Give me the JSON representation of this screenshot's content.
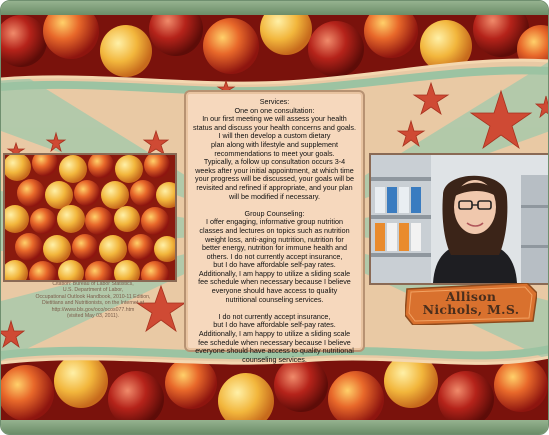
{
  "services": {
    "lines_intro": [
      "Services:",
      "One on one consultation:",
      "In our first meeting we will assess your health",
      "status and discuss your health concerns and goals.",
      "I will then develop a custom dietary",
      "plan along with lifestyle and supplement",
      "recommendations to meet your goals.",
      "Typically, a follow up consultation occurs 3-4",
      "weeks after your initial appointment, at which time",
      "your progress will be discussed, your goals will be",
      "revisited and refined if appropriate, and your plan",
      "will be modified if necessary."
    ],
    "lines_group": [
      "Group Counseling:",
      "I offer engaging, informative group nutrition",
      "classes and lectures on topics such as nutrition",
      "weight loss, anti-aging nutrition, nutrition for",
      "better energy, nutrition for immune health and",
      "others. I do not currently accept insurance,",
      "but I do have affordable self-pay rates.",
      "Additionally, I am happy to utilize a sliding scale",
      "fee schedule when necessary because I believe",
      "everyone should have access to quality",
      "nutritional counseling services."
    ],
    "lines_insurance": [
      "I do not currently accept insurance,",
      "but I do have affordable self-pay rates.",
      "Additionally, I am happy to utilize a sliding scale",
      "fee schedule when necessary because I believe",
      "everyone should have access to quality nutritional",
      "counseling services."
    ]
  },
  "citation": {
    "lines": [
      "Citation: Bureau of Labor Statistics,",
      "U.S. Department of Labor,",
      "Occupational Outlook Handbook, 2010-11 Edition,",
      "Dietitians and Nutritionists, on the Internet at",
      "http://www.bls.gov/oco/ocos077.htm",
      "(visited May 03, 2011)."
    ]
  },
  "nameplate": {
    "line1": "Allison",
    "line2": "Nichols, M.S."
  },
  "colors": {
    "frame_bar": "#7d9c78",
    "background_tan": "#e9c9a4",
    "band_green": "#9cc3a2",
    "star_red": "#cf4a34",
    "panel_fill": "#f6d8bd",
    "plate_orange": "#d9712e",
    "cherry_red": "#c0241a",
    "cherry_yellow": "#f0b43a"
  }
}
